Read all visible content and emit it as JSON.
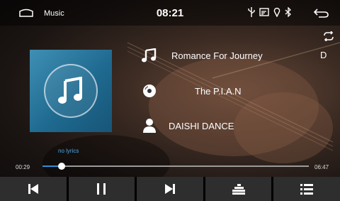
{
  "status_bar": {
    "app_name": "Music",
    "time": "08:21",
    "icons": [
      "home-icon",
      "usb-icon",
      "cast-icon",
      "location-icon",
      "bluetooth-icon",
      "back-arrow-icon"
    ]
  },
  "track": {
    "title": "Romance For Journey",
    "album": "The P.I.A.N",
    "artist": "DAISHI DANCE",
    "side_label": "D",
    "lyrics_text": "no lyrics"
  },
  "progress": {
    "current": "00:29",
    "total": "06:47",
    "fraction": 0.071
  },
  "controls": [
    {
      "name": "previous-button",
      "icon": "skip-previous-icon"
    },
    {
      "name": "pause-button",
      "icon": "pause-icon"
    },
    {
      "name": "next-button",
      "icon": "skip-next-icon"
    },
    {
      "name": "equalizer-button",
      "icon": "equalizer-icon"
    },
    {
      "name": "playlist-button",
      "icon": "playlist-icon"
    }
  ],
  "colors": {
    "accent": "#2f8fd6",
    "lyrics": "#4aa8e0",
    "album_art": "#2a7aa2",
    "control_bg": "#2e2e2e"
  }
}
